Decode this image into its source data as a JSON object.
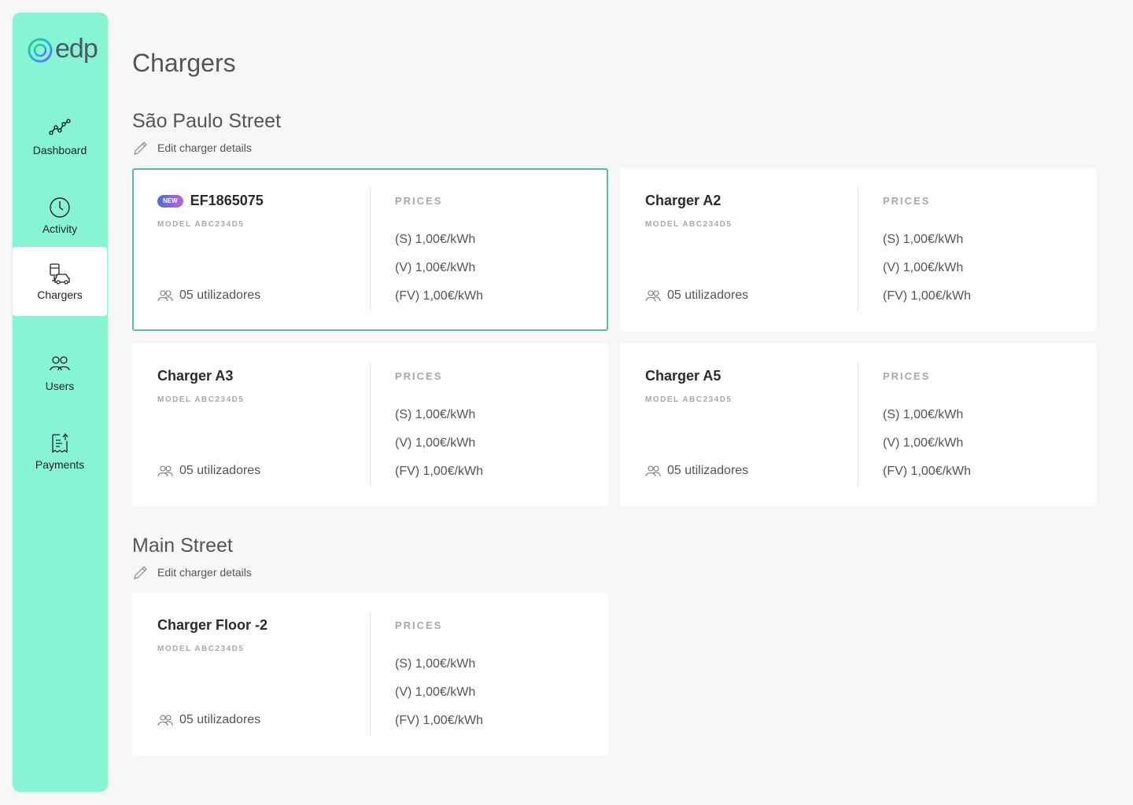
{
  "brand": {
    "logo_text": "edp"
  },
  "nav": [
    {
      "label": "Dashboard",
      "icon": "chart-line-icon",
      "active": false
    },
    {
      "label": "Activity",
      "icon": "clock-icon",
      "active": false
    },
    {
      "label": "Chargers",
      "icon": "charger-car-icon",
      "active": true
    },
    {
      "label": "Users",
      "icon": "users-icon",
      "active": false
    },
    {
      "label": "Payments",
      "icon": "receipt-icon",
      "active": false
    }
  ],
  "page": {
    "title": "Chargers"
  },
  "sections": [
    {
      "title": "São Paulo Street",
      "edit_label": "Edit charger details",
      "chargers": [
        {
          "badge": "NEW",
          "name": "EF1865075",
          "model": "MODEL ABC234D5",
          "users": "05 utilizadores",
          "prices_label": "PRICES",
          "prices": [
            "(S) 1,00€/kWh",
            "(V) 1,00€/kWh",
            "(FV) 1,00€/kWh"
          ],
          "selected": true
        },
        {
          "name": "Charger A2",
          "model": "MODEL ABC234D5",
          "users": "05 utilizadores",
          "prices_label": "PRICES",
          "prices": [
            "(S) 1,00€/kWh",
            "(V) 1,00€/kWh",
            "(FV) 1,00€/kWh"
          ]
        },
        {
          "name": "Charger A3",
          "model": "MODEL ABC234D5",
          "users": "05 utilizadores",
          "prices_label": "PRICES",
          "prices": [
            "(S) 1,00€/kWh",
            "(V) 1,00€/kWh",
            "(FV) 1,00€/kWh"
          ]
        },
        {
          "name": "Charger A5",
          "model": "MODEL ABC234D5",
          "users": "05 utilizadores",
          "prices_label": "PRICES",
          "prices": [
            "(S) 1,00€/kWh",
            "(V) 1,00€/kWh",
            "(FV) 1,00€/kWh"
          ]
        }
      ]
    },
    {
      "title": "Main Street",
      "edit_label": "Edit charger details",
      "chargers": [
        {
          "name": "Charger Floor -2",
          "model": "MODEL ABC234D5",
          "users": "05 utilizadores",
          "prices_label": "PRICES",
          "prices": [
            "(S) 1,00€/kWh",
            "(V) 1,00€/kWh",
            "(FV) 1,00€/kWh"
          ]
        }
      ]
    }
  ],
  "colors": {
    "sidebar": "#87f4d4",
    "selected_border": "#5bb9a7",
    "badge_start": "#4f6bd9",
    "badge_end": "#b865d8"
  }
}
